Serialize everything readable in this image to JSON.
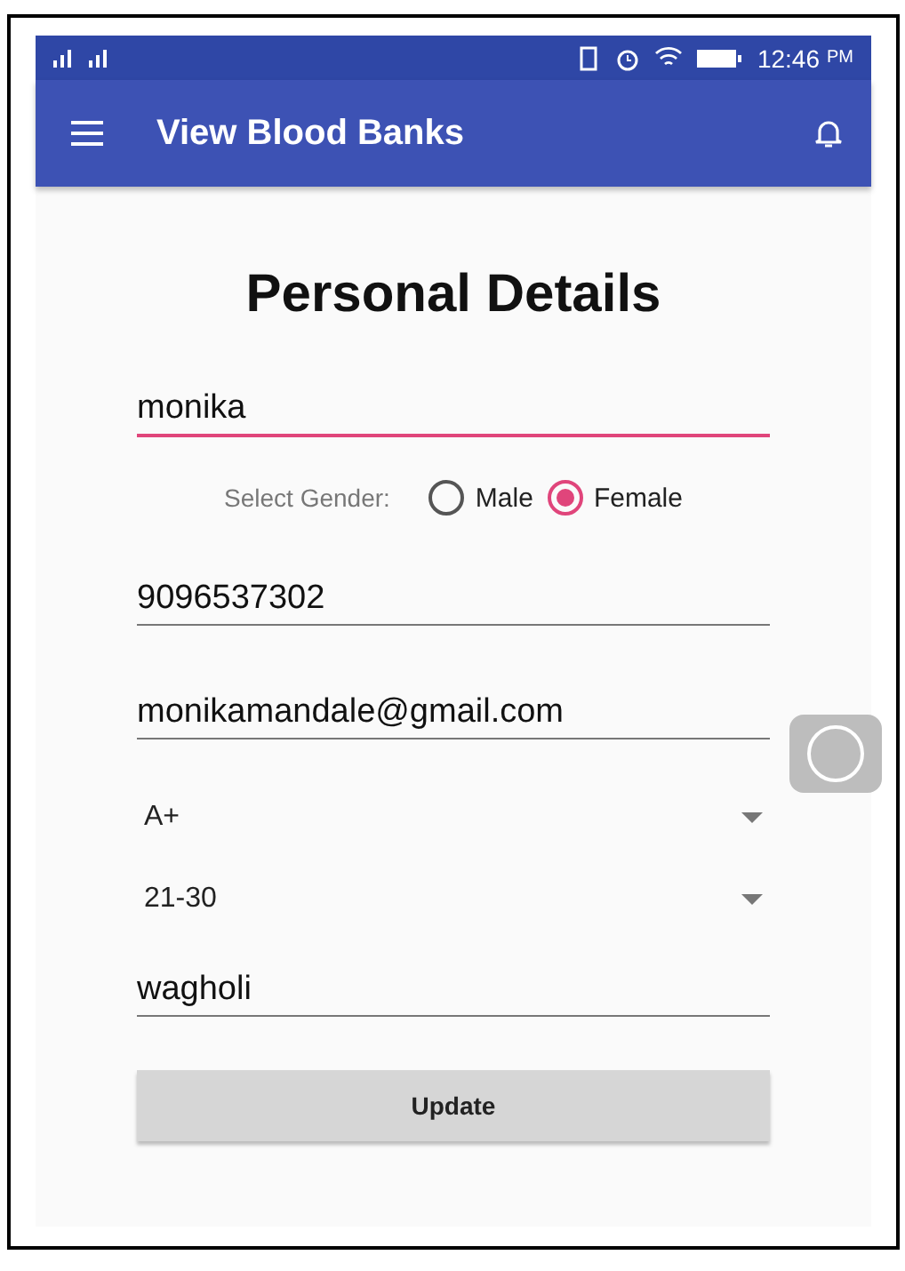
{
  "status_bar": {
    "time": "12:46",
    "meridiem": "PM"
  },
  "app_bar": {
    "title": "View Blood Banks"
  },
  "form": {
    "heading": "Personal Details",
    "fields": [
      {
        "kind": "text",
        "value": "monika",
        "focused": true
      },
      {
        "kind": "gender",
        "label": "Select Gender:",
        "options": [
          {
            "label": "Male",
            "selected": false
          },
          {
            "label": "Female",
            "selected": true
          }
        ]
      },
      {
        "kind": "text",
        "value": "9096537302",
        "focused": false
      },
      {
        "kind": "text",
        "value": "monikamandale@gmail.com",
        "focused": false
      },
      {
        "kind": "dropdown",
        "value": "A+"
      },
      {
        "kind": "dropdown",
        "value": "21-30"
      },
      {
        "kind": "text",
        "value": "wagholi",
        "focused": false
      }
    ],
    "button": "Update"
  }
}
